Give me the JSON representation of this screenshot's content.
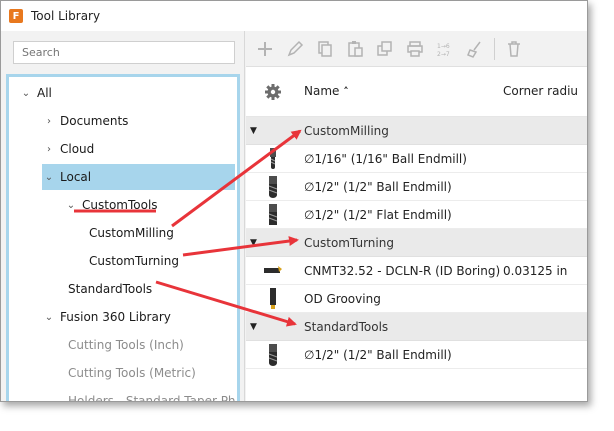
{
  "window": {
    "title": "Tool Library",
    "app_icon_letter": "F"
  },
  "search": {
    "placeholder": "Search"
  },
  "tree": {
    "all": "All",
    "documents": "Documents",
    "cloud": "Cloud",
    "local": "Local",
    "custom_tools": "CustomTools",
    "custom_milling": "CustomMilling",
    "custom_turning": "CustomTurning",
    "standard_tools": "StandardTools",
    "fusion_library": "Fusion 360 Library",
    "cutting_inch": "Cutting Tools (Inch)",
    "cutting_metric": "Cutting Tools (Metric)",
    "holders": "Holders - Standard Taper Ph"
  },
  "table": {
    "col_name": "Name",
    "col_corner": "Corner radiu",
    "groups": [
      {
        "name": "CustomMilling",
        "rows": [
          {
            "name": "∅1/16\" (1/16\" Ball Endmill)",
            "corner": ""
          },
          {
            "name": "∅1/2\" (1/2\" Ball Endmill)",
            "corner": ""
          },
          {
            "name": "∅1/2\" (1/2\" Flat Endmill)",
            "corner": ""
          }
        ]
      },
      {
        "name": "CustomTurning",
        "rows": [
          {
            "name": "CNMT32.52 - DCLN-R (ID Boring)",
            "corner": "0.03125 in"
          },
          {
            "name": "OD Grooving",
            "corner": ""
          }
        ]
      },
      {
        "name": "StandardTools",
        "rows": [
          {
            "name": "∅1/2\" (1/2\" Ball Endmill)",
            "corner": ""
          }
        ]
      }
    ]
  },
  "colors": {
    "accent": "#a7d5ec",
    "arrow": "#e8343a",
    "app_icon": "#e8781e"
  }
}
